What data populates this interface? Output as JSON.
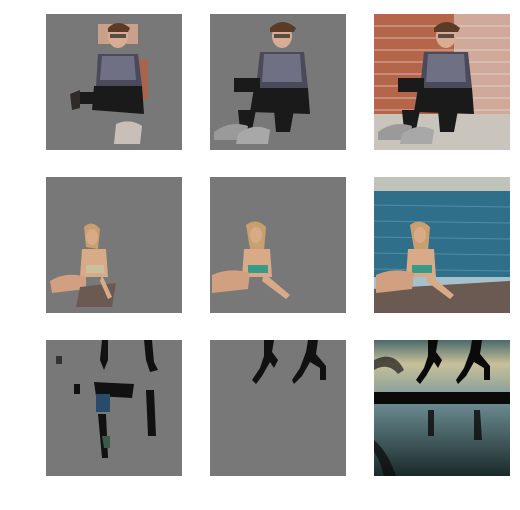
{
  "grid": {
    "rows": 3,
    "cols": 3,
    "rows_content": [
      {
        "subject": "man-sitting-brick-wall",
        "cells": [
          "coarse-mask",
          "refined-mask",
          "original-photo"
        ]
      },
      {
        "subject": "woman-on-rocks-by-sea",
        "cells": [
          "coarse-mask",
          "refined-mask",
          "original-photo"
        ]
      },
      {
        "subject": "runners-silhouette-reflection",
        "cells": [
          "coarse-mask",
          "refined-mask",
          "original-photo"
        ]
      }
    ]
  },
  "colors": {
    "background": "#ffffff",
    "mask_gray": "#787878",
    "brick": "#b5654a",
    "sea": "#2f6f8a",
    "sky_dusk": "#c9c09a"
  }
}
